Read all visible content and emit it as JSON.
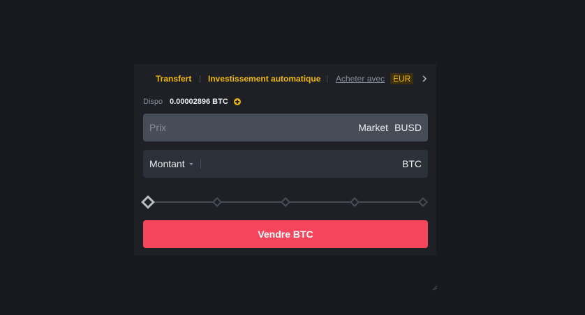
{
  "toplinks": {
    "transfer": "Transfert",
    "auto_invest": "Investissement automatique",
    "buy_with": "Acheter avec",
    "currency": "EUR"
  },
  "available": {
    "label": "Dispo",
    "value": "0.00002896 BTC"
  },
  "price_field": {
    "placeholder": "Prix",
    "mode": "Market",
    "unit": "BUSD"
  },
  "amount_field": {
    "selector": "Montant",
    "value": "",
    "unit": "BTC"
  },
  "slider": {
    "percent": 0,
    "marks": [
      0,
      25,
      50,
      75,
      100
    ]
  },
  "sell_button": {
    "label": "Vendre BTC"
  },
  "colors": {
    "accent": "#f0b90b",
    "sell": "#f6465d",
    "background": "#161a1e",
    "panel": "#1e2026"
  }
}
